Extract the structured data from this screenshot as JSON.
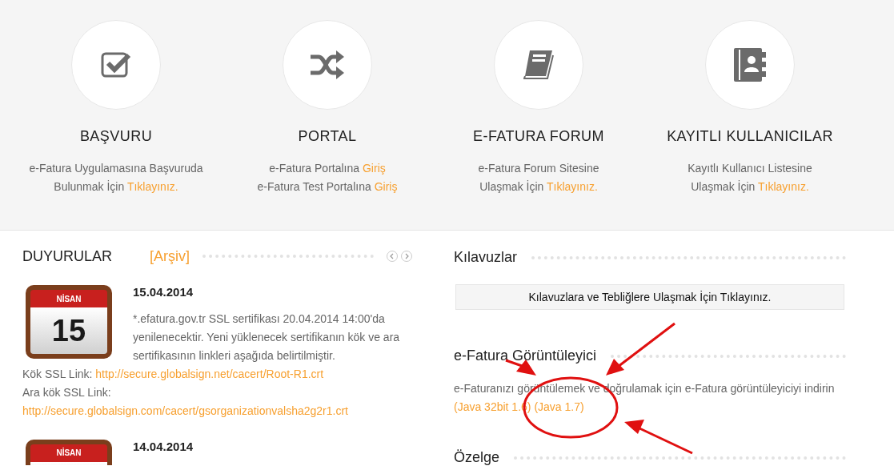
{
  "features": [
    {
      "title": "BAŞVURU",
      "description": [
        [
          {
            "text": "e-Fatura Uygulamasına Başvuruda",
            "kind": "plain"
          }
        ],
        [
          {
            "text": "Bulunmak İçin ",
            "kind": "plain"
          },
          {
            "text": "Tıklayınız.",
            "kind": "link"
          }
        ]
      ]
    },
    {
      "title": "PORTAL",
      "description": [
        [
          {
            "text": "e-Fatura Portalına ",
            "kind": "plain"
          },
          {
            "text": "Giriş",
            "kind": "link"
          }
        ],
        [
          {
            "text": "e-Fatura Test Portalına ",
            "kind": "plain"
          },
          {
            "text": "Giriş",
            "kind": "link"
          }
        ]
      ]
    },
    {
      "title": "E-FATURA FORUM",
      "description": [
        [
          {
            "text": "e-Fatura Forum Sitesine",
            "kind": "plain"
          }
        ],
        [
          {
            "text": "Ulaşmak İçin ",
            "kind": "plain"
          },
          {
            "text": "Tıklayınız.",
            "kind": "link"
          }
        ]
      ]
    },
    {
      "title": "KAYITLI KULLANICILAR",
      "description": [
        [
          {
            "text": "Kayıtlı Kullanıcı Listesine",
            "kind": "plain"
          }
        ],
        [
          {
            "text": "Ulaşmak İçin ",
            "kind": "plain"
          },
          {
            "text": "Tıklayınız.",
            "kind": "link"
          }
        ]
      ]
    }
  ],
  "announcements": {
    "title": "DUYURULAR",
    "archive_link": "[Arşiv]",
    "items": [
      {
        "month": "NİSAN",
        "day": "15",
        "date": "15.04.2014",
        "body": "*.efatura.gov.tr SSL sertifikası 20.04.2014 14:00'da yenilenecektir. Yeni yüklenecek sertifikanın kök ve ara sertifikasının linkleri aşağıda belirtilmiştir.",
        "links": [
          {
            "label": "Kök SSL Link:",
            "url": "http://secure.globalsign.net/cacert/Root-R1.crt"
          },
          {
            "label": "Ara kök SSL Link:",
            "url": "http://secure.globalsign.com/cacert/gsorganizationvalsha2g2r1.crt"
          }
        ]
      },
      {
        "month": "NİSAN",
        "date": "14.04.2014"
      }
    ]
  },
  "guides": {
    "title": "Kılavuzlar",
    "button": "Kılavuzlara ve Tebliğlere Ulaşmak İçin Tıklayınız."
  },
  "viewer": {
    "title": "e-Fatura Görüntüleyici",
    "text": "e-Faturanızı görüntülemek ve doğrulamak için e-Fatura görüntüleyiciyi indirin",
    "links": [
      "(Java 32bit 1.6)",
      "(Java 1.7)"
    ]
  },
  "rulings": {
    "title": "Özelge"
  }
}
